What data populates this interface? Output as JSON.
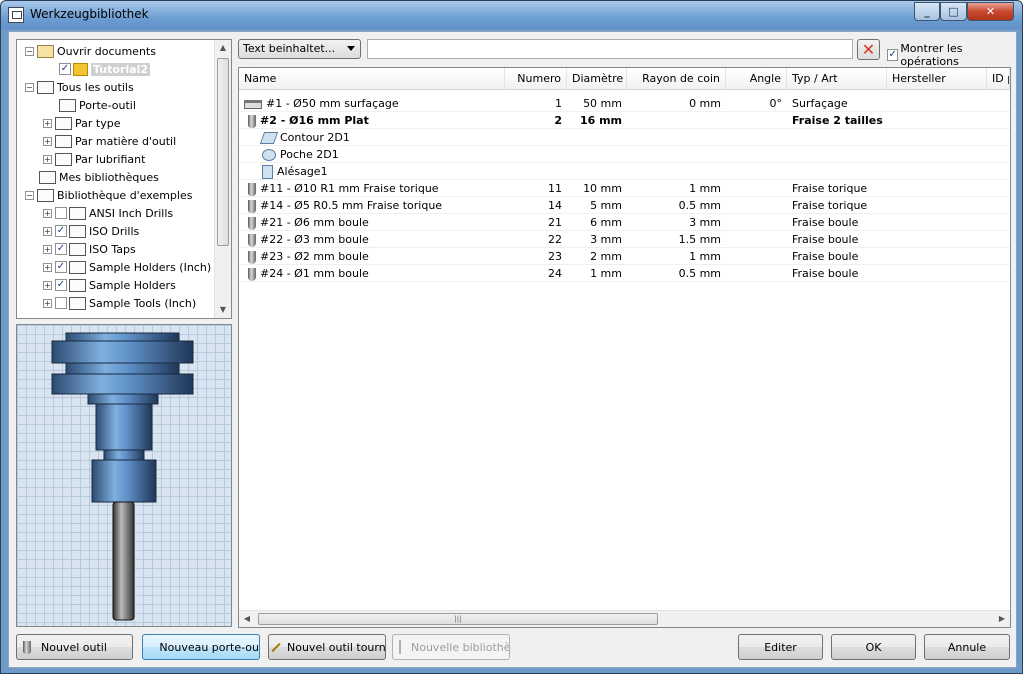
{
  "window": {
    "title": "Werkzeugbibliothek",
    "min": "_",
    "max": "□",
    "close": "✕"
  },
  "tree": {
    "items": [
      {
        "label": "Ouvrir documents",
        "expander": "−",
        "icon": "open-folder"
      },
      {
        "label": "Tutorial2",
        "checked": "✓",
        "icon": "part"
      },
      {
        "label": "Tous les outils",
        "expander": "−",
        "icon": "tool-library"
      },
      {
        "label": "Porte-outil",
        "icon": "holder"
      },
      {
        "label": "Par type",
        "expander": "+",
        "icon": "filter"
      },
      {
        "label": "Par matière d'outil",
        "expander": "+",
        "icon": "filter"
      },
      {
        "label": "Par lubrifiant",
        "expander": "+",
        "icon": "filter"
      },
      {
        "label": "Mes bibliothèques",
        "icon": "folder"
      },
      {
        "label": "Bibliothèque d'exemples",
        "expander": "−",
        "icon": "folder"
      },
      {
        "label": "ANSI Inch Drills",
        "expander": "+",
        "checked": "",
        "icon": "library"
      },
      {
        "label": "ISO Drills",
        "expander": "+",
        "checked": "✓",
        "icon": "library"
      },
      {
        "label": "ISO Taps",
        "expander": "+",
        "checked": "✓",
        "icon": "library"
      },
      {
        "label": "Sample Holders (Inch)",
        "expander": "+",
        "checked": "✓",
        "icon": "library"
      },
      {
        "label": "Sample Holders",
        "expander": "+",
        "checked": "✓",
        "icon": "library"
      },
      {
        "label": "Sample Tools (Inch)",
        "expander": "+",
        "checked": "",
        "icon": "library"
      }
    ],
    "scroll_up": "▲",
    "scroll_down": "▼"
  },
  "filter": {
    "selected": "Text beinhaltet...",
    "search_value": "",
    "clear_icon": "✕",
    "show_ops_label": "Montrer les opérations",
    "show_ops_checked": "✓"
  },
  "table": {
    "columns": [
      "Name",
      "Numero",
      "Diamètre",
      "Rayon de coin",
      "Angle",
      "Typ / Art",
      "Hersteller",
      "ID p"
    ],
    "rows": [
      {
        "name": "#1 - Ø50 mm surfaçage",
        "numero": "1",
        "diametre": "50 mm",
        "rayon": "0 mm",
        "angle": "0°",
        "type": "Surfaçage",
        "icon": "face-mill"
      },
      {
        "name": "#2 - Ø16 mm Plat",
        "numero": "2",
        "diametre": "16 mm",
        "rayon": "",
        "angle": "",
        "type": "Fraise 2 tailles",
        "icon": "end-mill"
      },
      {
        "name": "Contour 2D1",
        "numero": "",
        "diametre": "",
        "rayon": "",
        "angle": "",
        "type": "",
        "icon": "contour-op"
      },
      {
        "name": "Poche 2D1",
        "numero": "",
        "diametre": "",
        "rayon": "",
        "angle": "",
        "type": "",
        "icon": "pocket-op"
      },
      {
        "name": "Alésage1",
        "numero": "",
        "diametre": "",
        "rayon": "",
        "angle": "",
        "type": "",
        "icon": "bore-op"
      },
      {
        "name": "#11 - Ø10 R1 mm Fraise torique",
        "numero": "11",
        "diametre": "10 mm",
        "rayon": "1 mm",
        "angle": "",
        "type": "Fraise torique",
        "icon": "end-mill"
      },
      {
        "name": "#14 - Ø5 R0.5 mm Fraise torique",
        "numero": "14",
        "diametre": "5 mm",
        "rayon": "0.5 mm",
        "angle": "",
        "type": "Fraise torique",
        "icon": "end-mill"
      },
      {
        "name": "#21 - Ø6 mm boule",
        "numero": "21",
        "diametre": "6 mm",
        "rayon": "3 mm",
        "angle": "",
        "type": "Fraise boule",
        "icon": "ball-mill"
      },
      {
        "name": "#22 - Ø3 mm boule",
        "numero": "22",
        "diametre": "3 mm",
        "rayon": "1.5 mm",
        "angle": "",
        "type": "Fraise boule",
        "icon": "ball-mill"
      },
      {
        "name": "#23 - Ø2 mm boule",
        "numero": "23",
        "diametre": "2 mm",
        "rayon": "1 mm",
        "angle": "",
        "type": "Fraise boule",
        "icon": "ball-mill"
      },
      {
        "name": "#24 - Ø1 mm boule",
        "numero": "24",
        "diametre": "1 mm",
        "rayon": "0.5 mm",
        "angle": "",
        "type": "Fraise boule",
        "icon": "ball-mill"
      }
    ],
    "hscroll_left": "◀",
    "hscroll_right": "▶",
    "hscroll_grip": "|||"
  },
  "buttons": {
    "new_tool": "Nouvel outil",
    "new_holder": "Nouveau porte-ou",
    "new_turning": "Nouvel outil tourna",
    "new_library": "Nouvelle bibliothè",
    "edit": "Editer",
    "ok": "OK",
    "cancel": "Annule"
  }
}
